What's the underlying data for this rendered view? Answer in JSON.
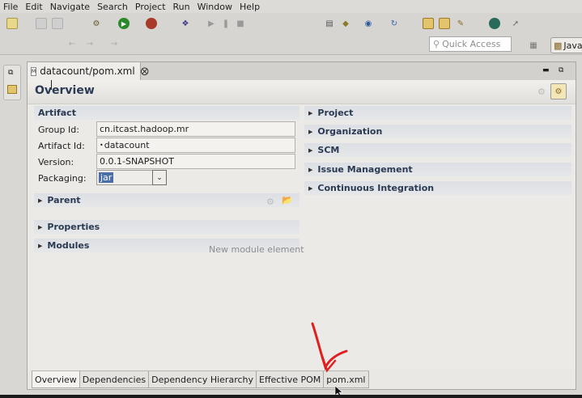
{
  "menu": [
    "File",
    "Edit",
    "Navigate",
    "Search",
    "Project",
    "Run",
    "Window",
    "Help"
  ],
  "toolbar": {
    "quick_access_placeholder": "Quick Access",
    "perspective_label": "Java"
  },
  "editor": {
    "tab_title": "datacount/pom.xml",
    "tab_close": "⨂",
    "form_title": "Overview"
  },
  "artifact": {
    "section_title": "Artifact",
    "group_id_label": "Group Id:",
    "group_id_value": "cn.itcast.hadoop.mr",
    "artifact_id_label": "Artifact Id:",
    "artifact_id_value": "datacount",
    "version_label": "Version:",
    "version_value": "0.0.1-SNAPSHOT",
    "packaging_label": "Packaging:",
    "packaging_value": "jar"
  },
  "left_sections": {
    "parent": "Parent",
    "properties": "Properties",
    "modules": "Modules",
    "modules_hint": "New module element"
  },
  "right_sections": [
    "Project",
    "Organization",
    "SCM",
    "Issue Management",
    "Continuous Integration"
  ],
  "bottom_tabs": [
    "Overview",
    "Dependencies",
    "Dependency Hierarchy",
    "Effective POM",
    "pom.xml"
  ],
  "colors": {
    "section_title": "#2a3a52",
    "annotation_red": "#e02020",
    "selection": "#4a6ea8"
  }
}
